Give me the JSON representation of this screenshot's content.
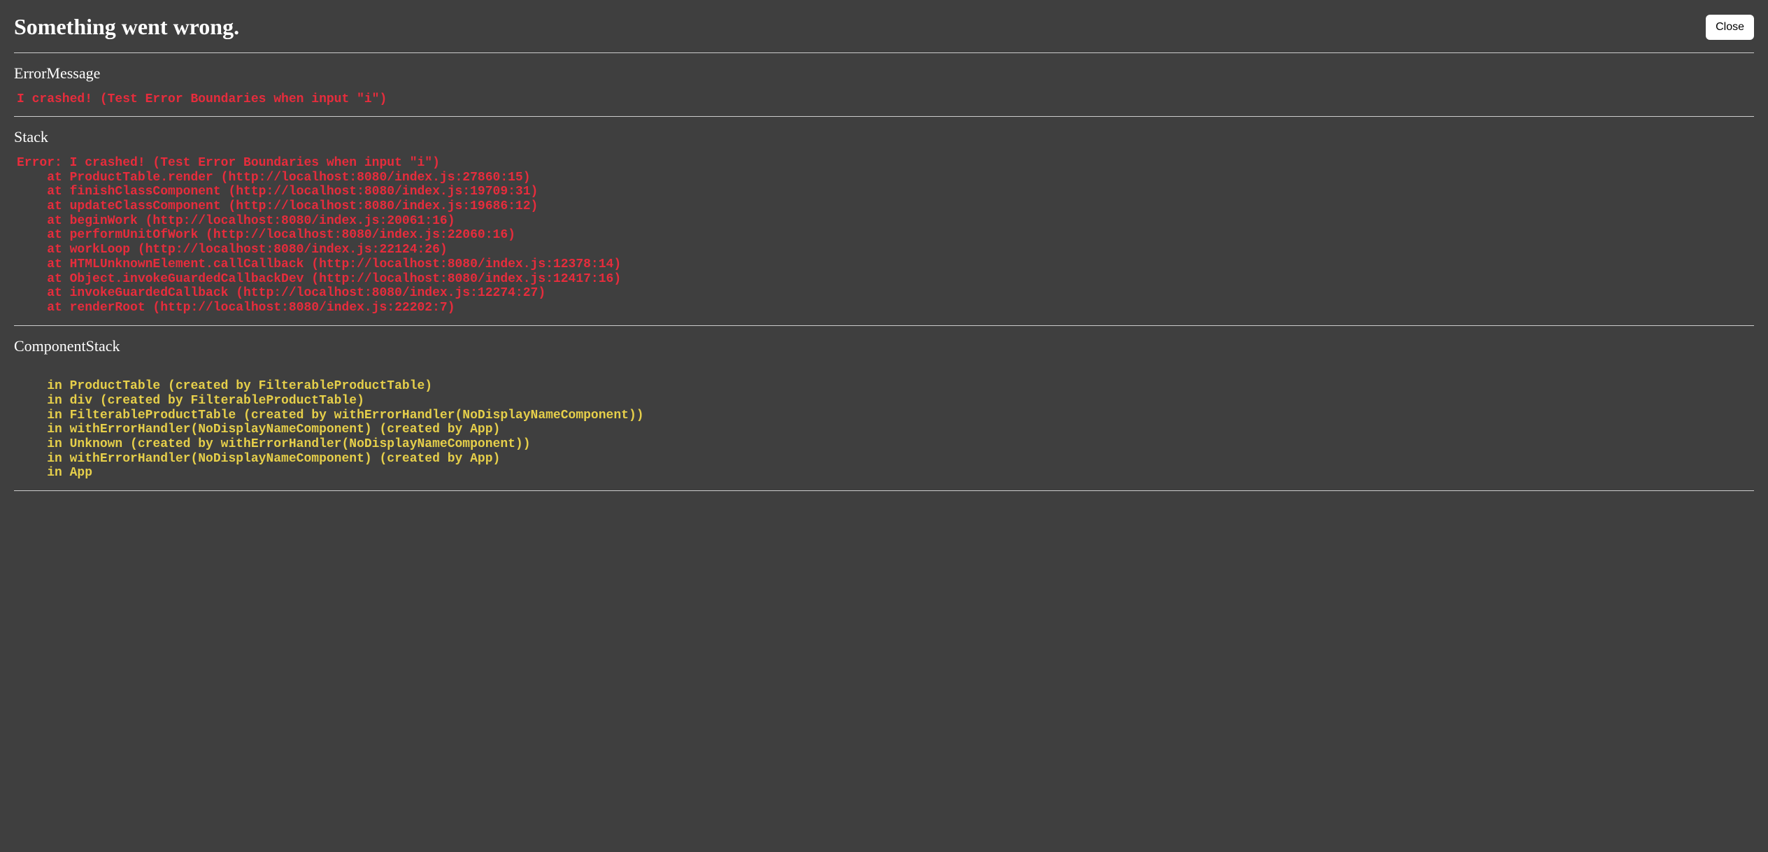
{
  "header": {
    "title": "Something went wrong.",
    "close_label": "Close"
  },
  "sections": {
    "error_message": {
      "title": "ErrorMessage",
      "content": "I crashed! (Test Error Boundaries when input \"i\")"
    },
    "stack": {
      "title": "Stack",
      "content": "Error: I crashed! (Test Error Boundaries when input \"i\")\n    at ProductTable.render (http://localhost:8080/index.js:27860:15)\n    at finishClassComponent (http://localhost:8080/index.js:19709:31)\n    at updateClassComponent (http://localhost:8080/index.js:19686:12)\n    at beginWork (http://localhost:8080/index.js:20061:16)\n    at performUnitOfWork (http://localhost:8080/index.js:22060:16)\n    at workLoop (http://localhost:8080/index.js:22124:26)\n    at HTMLUnknownElement.callCallback (http://localhost:8080/index.js:12378:14)\n    at Object.invokeGuardedCallbackDev (http://localhost:8080/index.js:12417:16)\n    at invokeGuardedCallback (http://localhost:8080/index.js:12274:27)\n    at renderRoot (http://localhost:8080/index.js:22202:7)"
    },
    "component_stack": {
      "title": "ComponentStack",
      "content": "\n    in ProductTable (created by FilterableProductTable)\n    in div (created by FilterableProductTable)\n    in FilterableProductTable (created by withErrorHandler(NoDisplayNameComponent))\n    in withErrorHandler(NoDisplayNameComponent) (created by App)\n    in Unknown (created by withErrorHandler(NoDisplayNameComponent))\n    in withErrorHandler(NoDisplayNameComponent) (created by App)\n    in App"
    }
  }
}
